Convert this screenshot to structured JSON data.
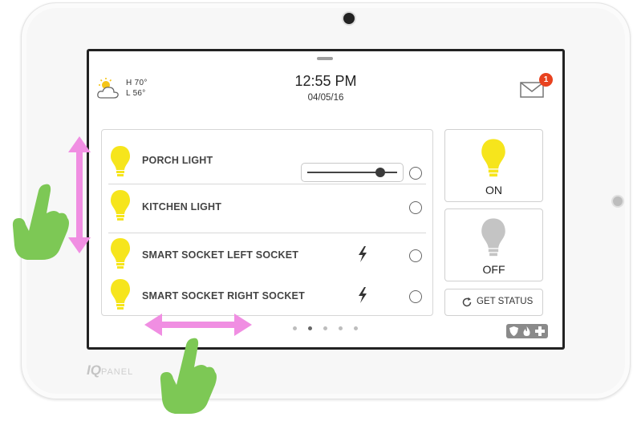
{
  "header": {
    "weather": {
      "icon": "partly-cloudy-icon",
      "high": "H 70°",
      "low": "L 56°"
    },
    "time": "12:55 PM",
    "date": "04/05/16",
    "messages": {
      "icon": "envelope-icon",
      "count": "1"
    }
  },
  "devices": [
    {
      "name": "PORCH LIGHT",
      "state": "on",
      "control": "dimmer",
      "dimmer_level": 0.85
    },
    {
      "name": "KITCHEN LIGHT",
      "state": "on"
    },
    {
      "name": "SMART SOCKET LEFT SOCKET",
      "state": "on",
      "icon": "power-bolt-icon"
    },
    {
      "name": "SMART SOCKET RIGHT SOCKET",
      "state": "on",
      "icon": "power-bolt-icon"
    }
  ],
  "actions": {
    "on_label": "ON",
    "off_label": "OFF",
    "get_status_label": "GET STATUS"
  },
  "pagination": {
    "pages": 5,
    "current": 2
  },
  "emergency": {
    "icons": [
      "shield-icon",
      "fire-icon",
      "medical-cross-icon"
    ]
  },
  "brand": {
    "logo_iq": "IQ",
    "logo_panel": "PANEL"
  },
  "colors": {
    "bulb_on": "#f6e51c",
    "bulb_off": "#c4c4c4",
    "gesture_arrow": "#f08ee2",
    "gesture_hand": "#7dc855",
    "badge": "#e8421f"
  }
}
